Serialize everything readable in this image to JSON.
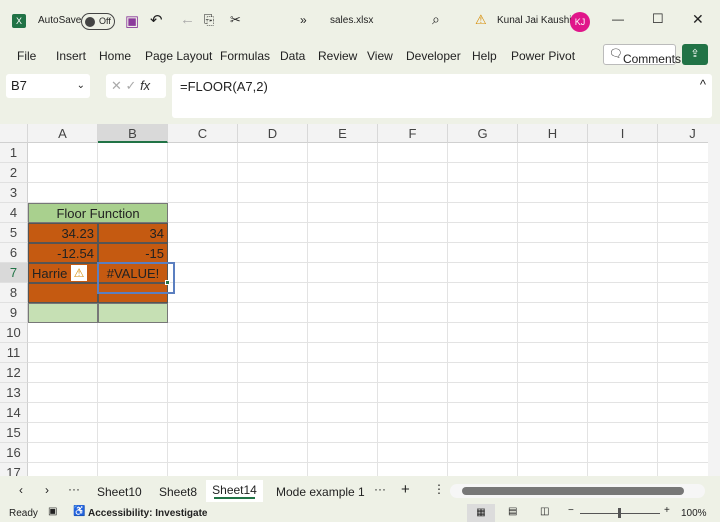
{
  "titlebar": {
    "autosave": "AutoSave",
    "toggle": "Off",
    "filename": "sales.xlsx",
    "user": "Kunal Jai Kaushik",
    "initials": "KJ"
  },
  "menu": [
    "File",
    "Insert",
    "Home",
    "Page Layout",
    "Formulas",
    "Data",
    "Review",
    "View",
    "Developer",
    "Help",
    "Power Pivot"
  ],
  "comments": "Comments",
  "formula": {
    "namebox": "B7",
    "fx": "fx",
    "value": "=FLOOR(A7,2)"
  },
  "columns": [
    "A",
    "B",
    "C",
    "D",
    "E",
    "F",
    "G",
    "H",
    "I",
    "J"
  ],
  "rows": [
    "1",
    "2",
    "3",
    "4",
    "5",
    "6",
    "7",
    "8",
    "9",
    "10",
    "11",
    "12",
    "13",
    "14",
    "15",
    "16",
    "17"
  ],
  "cells": {
    "title": "Floor Function",
    "a5": "34.23",
    "b5": "34",
    "a6": "-12.54",
    "b6": "-15",
    "a7": "Harrie",
    "b7": "#VALUE!"
  },
  "colors": {
    "header_green": "#a9d08e",
    "orange": "#c55a11",
    "light_green": "#c6e0b4",
    "accent": "#217346"
  },
  "sheets": [
    "Sheet10",
    "Sheet8",
    "Sheet14",
    "Mode example 1"
  ],
  "active_sheet": "Sheet14",
  "status": {
    "ready": "Ready",
    "accessibility": "Accessibility: Investigate",
    "zoom": "100%"
  }
}
